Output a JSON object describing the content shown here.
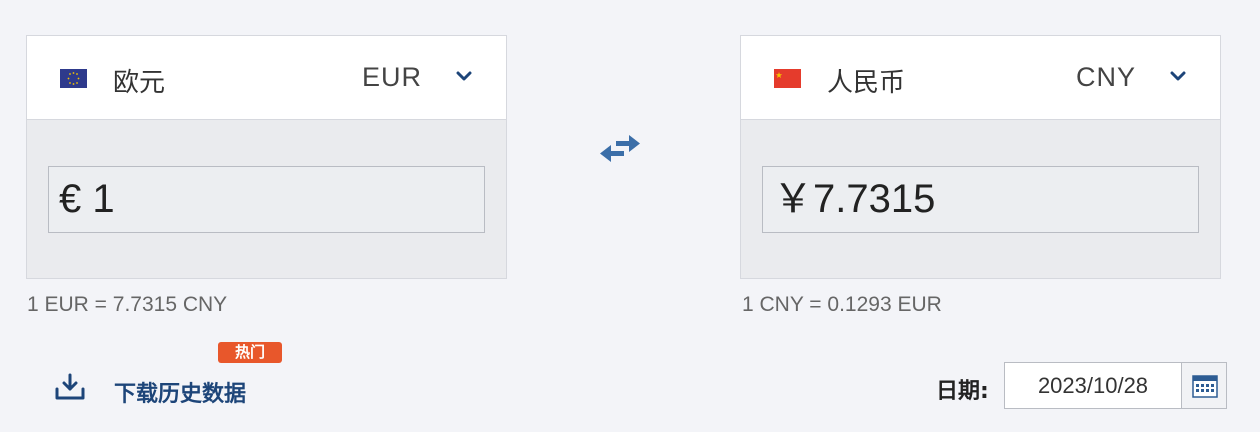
{
  "colors": {
    "background": "#f3f4f8",
    "accent": "#1d4579",
    "hot_badge": "#e8572b",
    "eu_flag": "#2e3a8c",
    "cn_flag": "#e53b2c"
  },
  "from": {
    "flag_icon": "eu-flag-icon",
    "name": "欧元",
    "code": "EUR",
    "amount_display": "€ 1",
    "rate_text": "1 EUR = 7.7315 CNY"
  },
  "to": {
    "flag_icon": "cn-flag-icon",
    "name": "人民币",
    "code": "CNY",
    "amount_display": "￥7.7315",
    "rate_text": "1 CNY = 0.1293 EUR"
  },
  "swap_icon": "swap-arrows-icon",
  "download": {
    "icon": "download-icon",
    "label": "下载历史数据",
    "badge": "热门"
  },
  "date": {
    "label": "日期:",
    "value": "2023/10/28",
    "icon": "calendar-icon"
  }
}
